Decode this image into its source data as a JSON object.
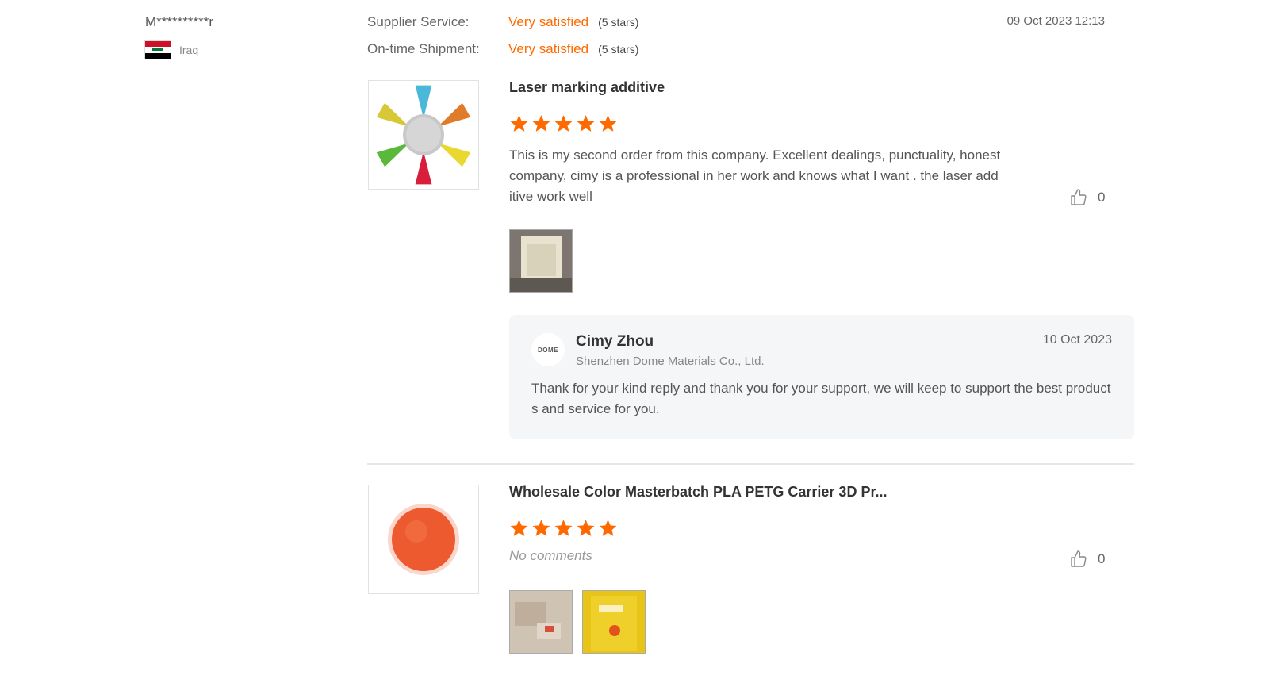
{
  "reviewer": {
    "name": "M**********r",
    "country": "Iraq"
  },
  "ratings": [
    {
      "label": "Supplier Service:",
      "value": "Very satisfied",
      "stars_text": "(5 stars)"
    },
    {
      "label": "On-time Shipment:",
      "value": "Very satisfied",
      "stars_text": "(5 stars)"
    }
  ],
  "review_date": "09 Oct 2023 12:13",
  "reviews": [
    {
      "product_title": "Laser marking additive",
      "rating": 5,
      "comment": "This is my second order from this company. Excellent dealings, punctuality, honest company, cimy is a professional in her work and knows what I want . the laser additive work well",
      "likes": "0",
      "photo_count": 1
    },
    {
      "product_title": "Wholesale Color Masterbatch PLA PETG Carrier 3D Pr...",
      "rating": 5,
      "comment": "No comments",
      "likes": "0",
      "photo_count": 2
    }
  ],
  "reply": {
    "avatar_text": "DOME",
    "name": "Cimy Zhou",
    "company": "Shenzhen Dome Materials Co., Ltd.",
    "date": "10 Oct 2023",
    "text": "Thank for your kind reply and thank you for your support, we will keep to support the best products and service for you."
  },
  "colors": {
    "accent": "#ff6a00",
    "reply_bg": "#f5f6f8"
  },
  "icons": {
    "star": "star-icon",
    "like": "thumbs-up-icon"
  }
}
